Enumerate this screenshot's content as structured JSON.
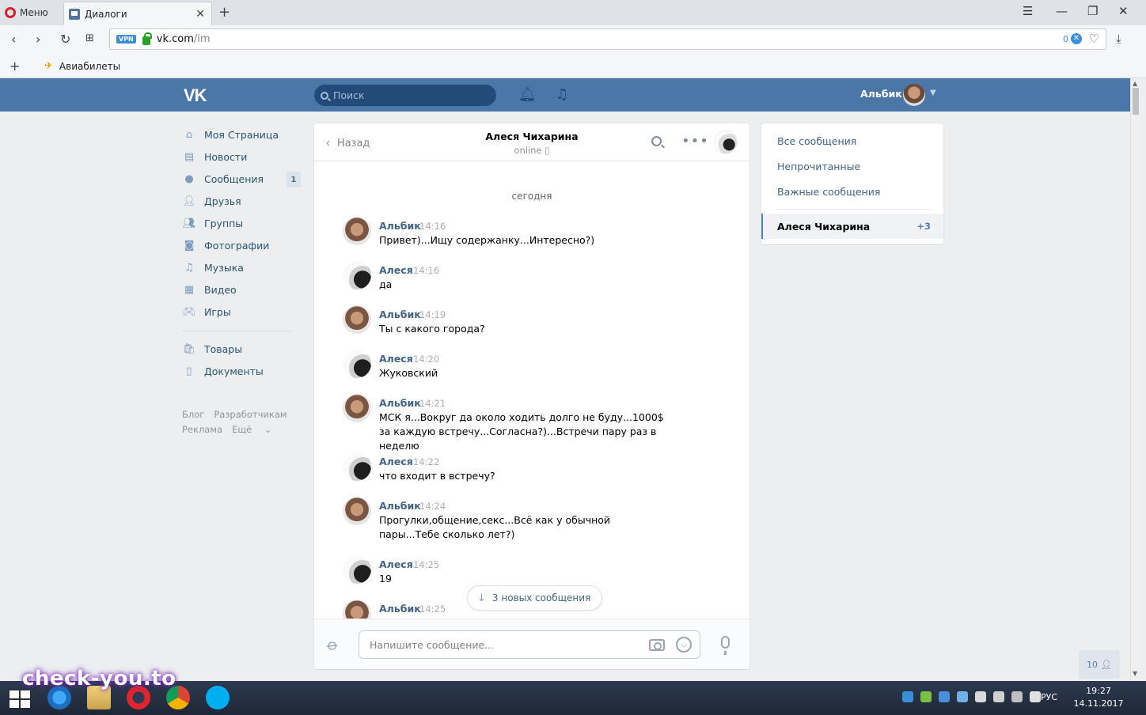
{
  "browser": {
    "menu_label": "Меню",
    "tab_title": "Диалоги",
    "url_host": "vk.com",
    "url_path": "/im",
    "vpn_label": "VPN",
    "adblock_count": "0",
    "bookmark_label": "Авиабилеты"
  },
  "vk": {
    "logo": "VK",
    "search_placeholder": "Поиск",
    "user_name": "Альбик"
  },
  "left_menu": {
    "items": [
      {
        "label": "Моя Страница",
        "icon": "home-icon"
      },
      {
        "label": "Новости",
        "icon": "news-icon"
      },
      {
        "label": "Сообщения",
        "icon": "messages-icon",
        "badge": "1"
      },
      {
        "label": "Друзья",
        "icon": "friends-icon"
      },
      {
        "label": "Группы",
        "icon": "groups-icon"
      },
      {
        "label": "Фотографии",
        "icon": "photo-icon"
      },
      {
        "label": "Музыка",
        "icon": "music-icon"
      },
      {
        "label": "Видео",
        "icon": "video-icon"
      },
      {
        "label": "Игры",
        "icon": "games-icon"
      }
    ],
    "items2": [
      {
        "label": "Товары",
        "icon": "market-icon"
      },
      {
        "label": "Документы",
        "icon": "docs-icon"
      }
    ],
    "footer": [
      "Блог",
      "Разработчикам",
      "Реклама",
      "Ещё"
    ]
  },
  "chat": {
    "back_label": "Назад",
    "peer_name": "Алеся Чихарина",
    "peer_status": "online",
    "day_label": "сегодня",
    "messages": [
      {
        "author": "Альбик",
        "time": "14:16",
        "text": "Привет)...Ищу содержанку...Интересно?)"
      },
      {
        "author": "Алеся",
        "time": "14:16",
        "text": "да"
      },
      {
        "author": "Альбик",
        "time": "14:19",
        "text": "Ты с какого города?"
      },
      {
        "author": "Алеся",
        "time": "14:20",
        "text": "Жуковский"
      },
      {
        "author": "Альбик",
        "time": "14:21",
        "text": "МСК я...Вокруг да около ходить долго не буду...1000$ за каждую встречу...Согласна?)...Встречи пару раз в неделю"
      },
      {
        "author": "Алеся",
        "time": "14:22",
        "text": "что входит в встречу?"
      },
      {
        "author": "Альбик",
        "time": "14:24",
        "text": "Прогулки,общение,секс...Всё как у обычной пары...Тебе сколько лет?)"
      },
      {
        "author": "Алеся",
        "time": "14:25",
        "text": "19"
      },
      {
        "author": "Альбик",
        "time": "14:25",
        "text": ""
      }
    ],
    "new_messages_label": "3 новых сообщения",
    "composer_placeholder": "Напишите сообщение..."
  },
  "right_panel": {
    "all": "Все сообщения",
    "unread": "Непрочитанные",
    "important": "Важные сообщения",
    "active_name": "Алеся Чихарина",
    "active_count": "+3"
  },
  "online_count": "10",
  "taskbar": {
    "lang": "РУС",
    "time": "19:27",
    "date": "14.11.2017"
  },
  "watermark": "check-you.to"
}
